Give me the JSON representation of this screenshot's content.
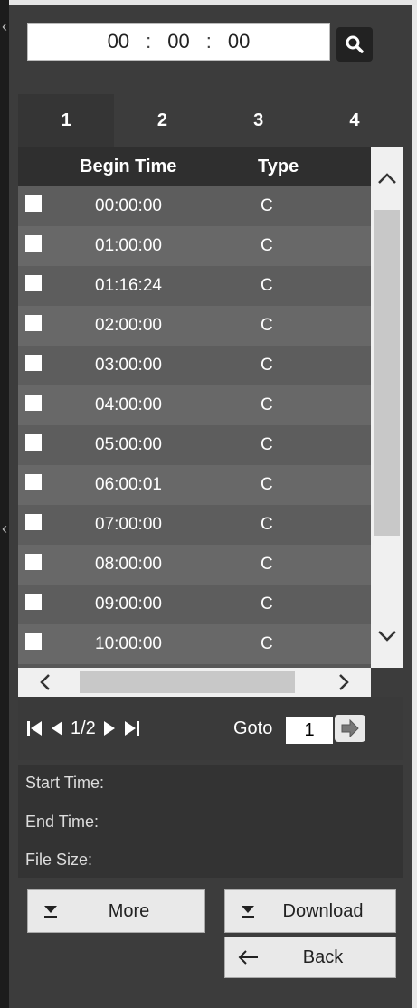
{
  "time": {
    "h": "00",
    "m": "00",
    "s": "00",
    "sep": ":"
  },
  "tabs": [
    {
      "label": "1"
    },
    {
      "label": "2"
    },
    {
      "label": "3"
    },
    {
      "label": "4"
    }
  ],
  "table": {
    "headers": {
      "begin": "Begin Time",
      "type": "Type"
    },
    "rows": [
      {
        "time": "00:00:00",
        "type": "C"
      },
      {
        "time": "01:00:00",
        "type": "C"
      },
      {
        "time": "01:16:24",
        "type": "C"
      },
      {
        "time": "02:00:00",
        "type": "C"
      },
      {
        "time": "03:00:00",
        "type": "C"
      },
      {
        "time": "04:00:00",
        "type": "C"
      },
      {
        "time": "05:00:00",
        "type": "C"
      },
      {
        "time": "06:00:01",
        "type": "C"
      },
      {
        "time": "07:00:00",
        "type": "C"
      },
      {
        "time": "08:00:00",
        "type": "C"
      },
      {
        "time": "09:00:00",
        "type": "C"
      },
      {
        "time": "10:00:00",
        "type": "C"
      }
    ]
  },
  "pager": {
    "page": "1/2",
    "goto_label": "Goto",
    "goto_value": "1"
  },
  "info": {
    "start": "Start Time:",
    "end": "End Time:",
    "size": "File Size:"
  },
  "buttons": {
    "more": "More",
    "download": "Download",
    "back": "Back"
  }
}
